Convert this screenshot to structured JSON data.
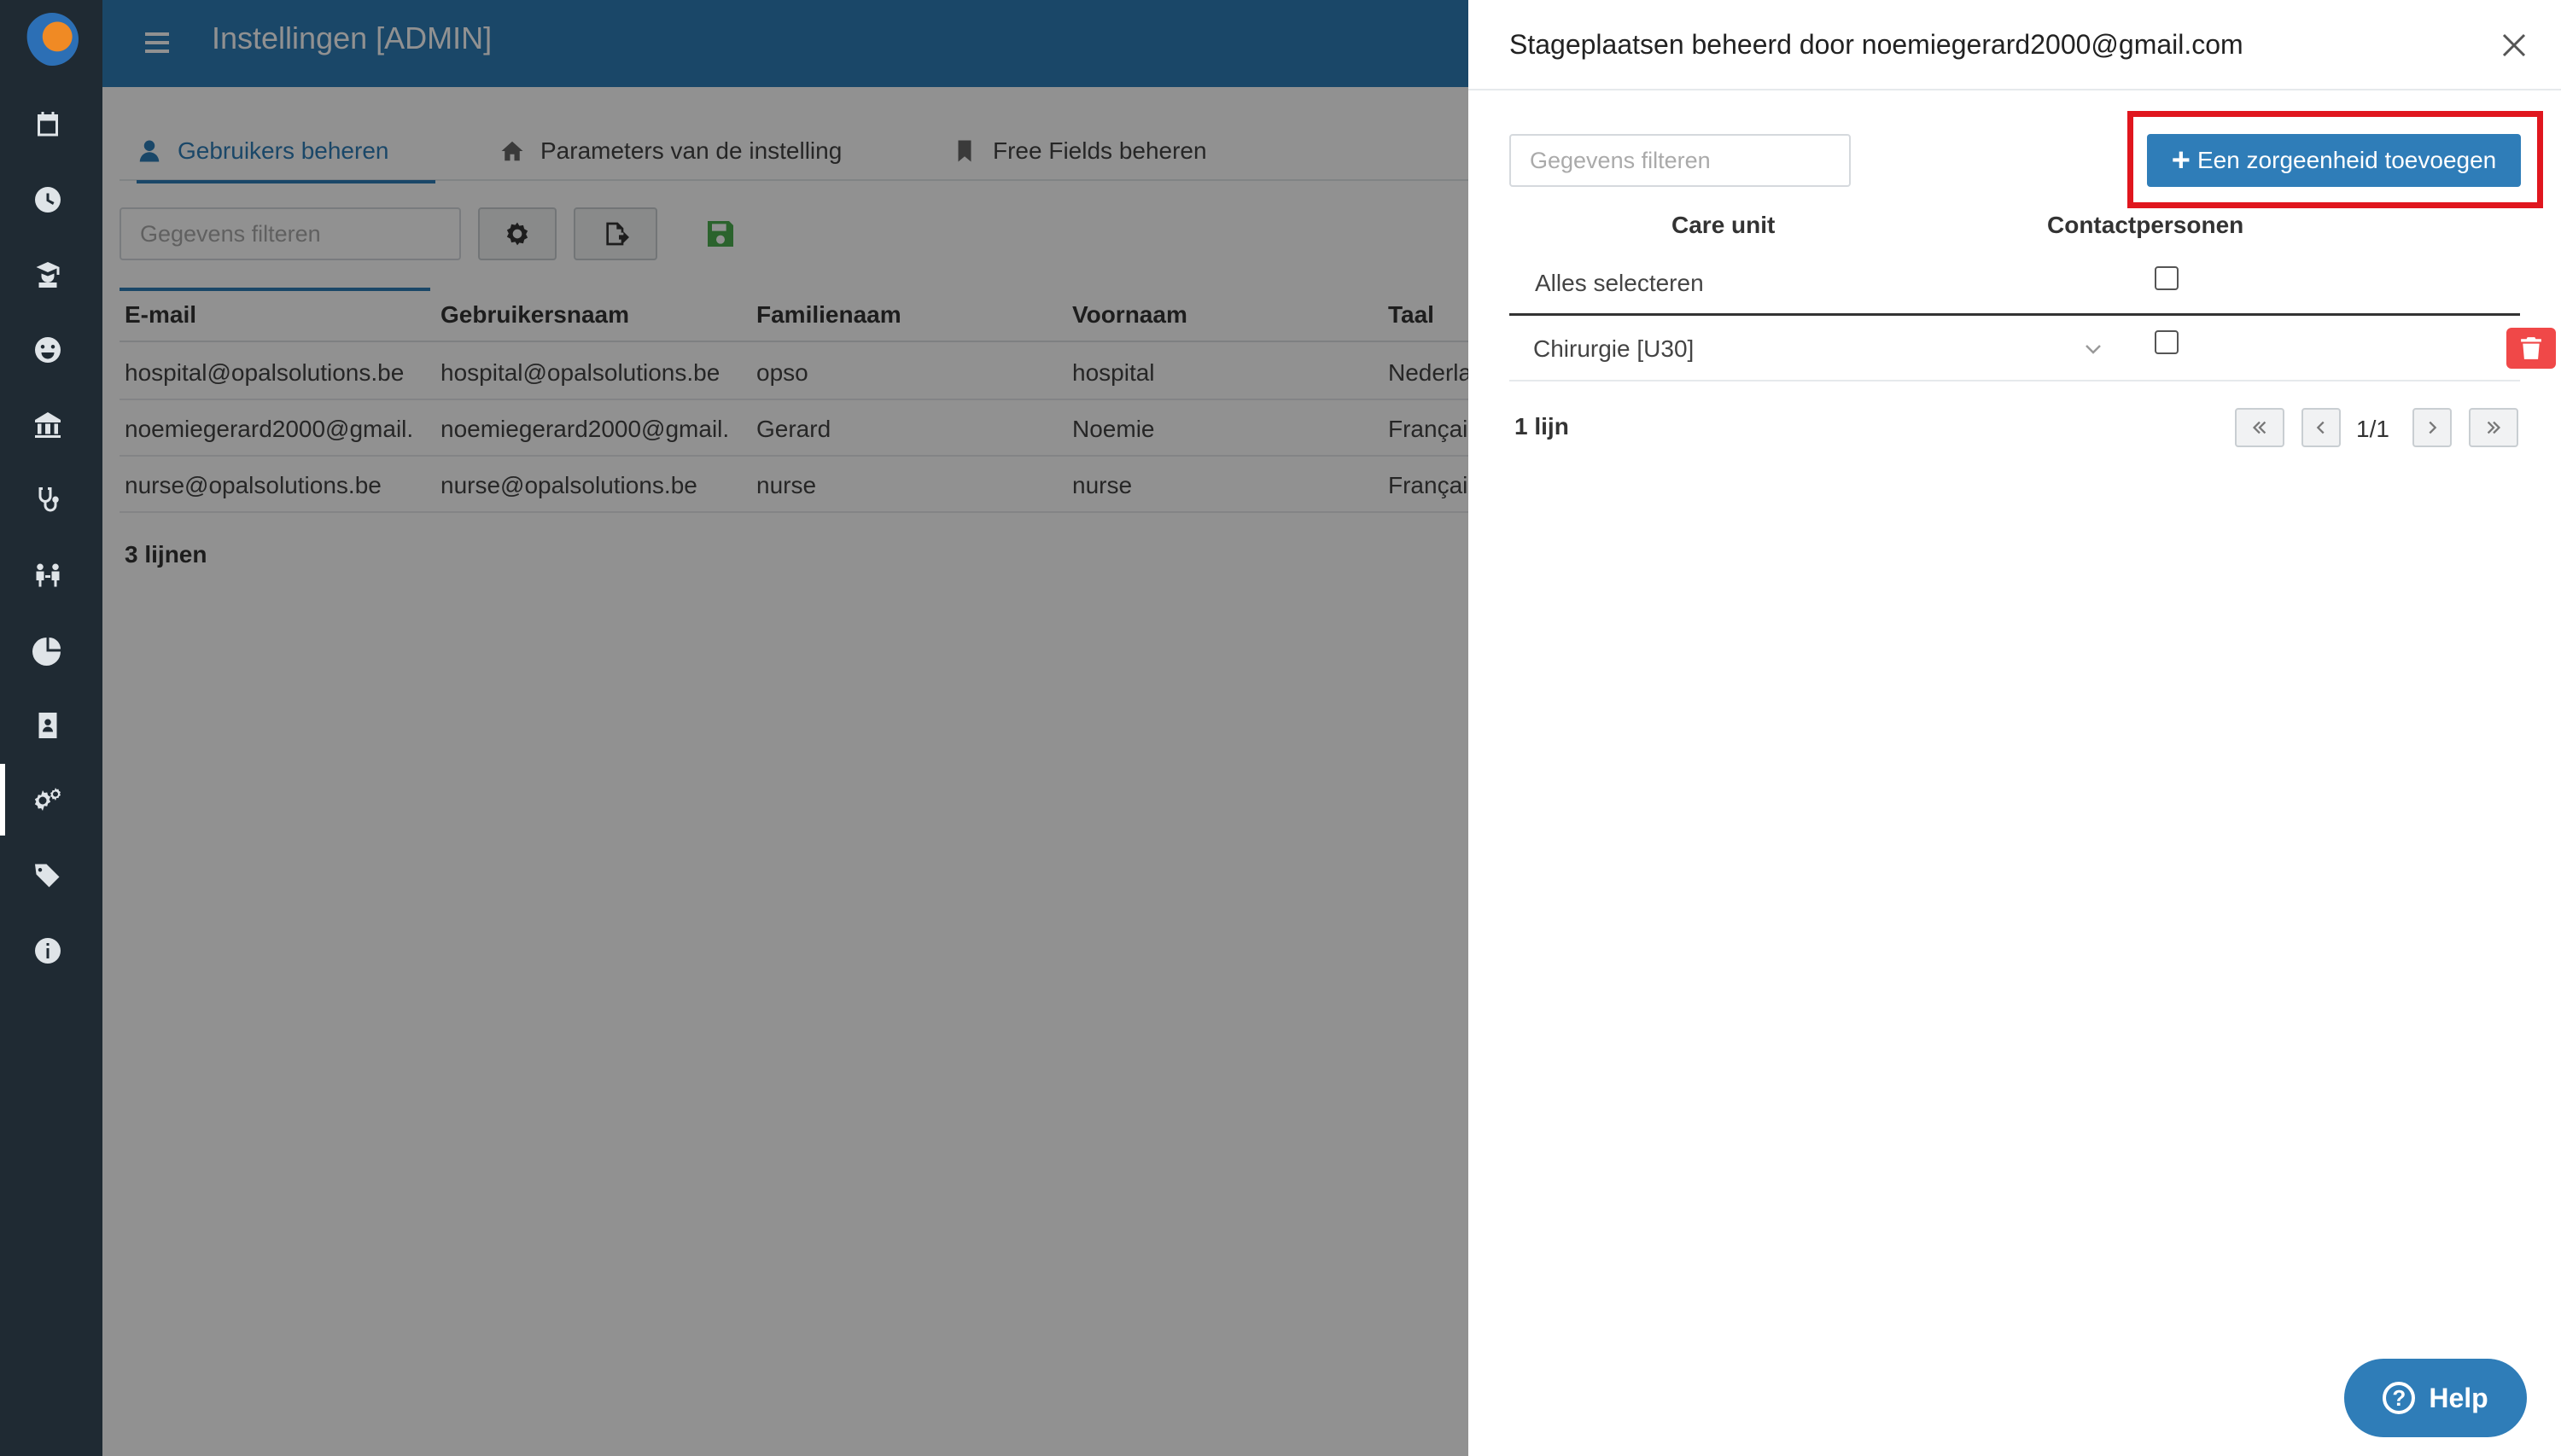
{
  "header": {
    "title": "Instellingen [ADMIN]"
  },
  "tabs": [
    {
      "label": "Gebruikers beheren"
    },
    {
      "label": "Parameters van de instelling"
    },
    {
      "label": "Free Fields beheren"
    }
  ],
  "main_filter": {
    "placeholder": "Gegevens filteren"
  },
  "users_table": {
    "columns": [
      "E-mail",
      "Gebruikersnaam",
      "Familienaam",
      "Voornaam",
      "Taal"
    ],
    "rows": [
      [
        "hospital@opalsolutions.be",
        "hospital@opalsolutions.be",
        "opso",
        "hospital",
        "Nederla"
      ],
      [
        "noemiegerard2000@gmail.",
        "noemiegerard2000@gmail.",
        "Gerard",
        "Noemie",
        "Françai"
      ],
      [
        "nurse@opalsolutions.be",
        "nurse@opalsolutions.be",
        "nurse",
        "nurse",
        "Françai"
      ]
    ],
    "count_label": "3 lijnen"
  },
  "drawer": {
    "title": "Stageplaatsen beheerd door noemiegerard2000@gmail.com",
    "filter_placeholder": "Gegevens filteren",
    "add_button_label": "Een zorgeenheid toevoegen",
    "columns": [
      "Care unit",
      "Contactpersonen"
    ],
    "select_all_label": "Alles selecteren",
    "rows": [
      {
        "care_unit": "Chirurgie [U30]"
      }
    ],
    "count_label": "1 lijn",
    "page_label": "1/1"
  },
  "help": {
    "label": "Help"
  },
  "colors": {
    "primary": "#2f7db8",
    "sidebar": "#1f2a33",
    "danger": "#f04848",
    "highlight": "#e0161e",
    "save_green": "#4caf50"
  }
}
